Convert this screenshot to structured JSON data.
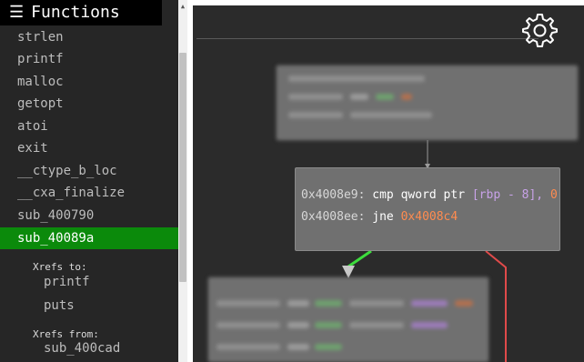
{
  "sidebar": {
    "title": "Functions",
    "hamburger_icon": "☰",
    "functions": [
      {
        "label": "strlen"
      },
      {
        "label": "printf"
      },
      {
        "label": "malloc"
      },
      {
        "label": "getopt"
      },
      {
        "label": "atoi"
      },
      {
        "label": "exit"
      },
      {
        "label": "__ctype_b_loc"
      },
      {
        "label": "__cxa_finalize"
      },
      {
        "label": "sub_400790"
      },
      {
        "label": "sub_40089a",
        "active": true
      }
    ],
    "xrefs_to_title": "Xrefs to:",
    "xrefs_to": [
      "printf",
      "puts"
    ],
    "xrefs_from_title": "Xrefs from:",
    "xrefs_from": [
      "sub_400cad"
    ]
  },
  "graph": {
    "current_block": [
      {
        "addr": "0x4008e9:",
        "ins": "cmp qword ptr",
        "operand": "[rbp - 8],",
        "imm": "0"
      },
      {
        "addr": "0x4008ee:",
        "ins": "jne",
        "target": "0x4008c4"
      }
    ],
    "settings_icon": "gear-icon"
  },
  "colors": {
    "active_item": "#0b8a0b",
    "true_edge": "#3ddc3d",
    "false_edge": "#e04a4a",
    "canvas_bg": "#2b2b2b",
    "node_bg": "#707070"
  }
}
